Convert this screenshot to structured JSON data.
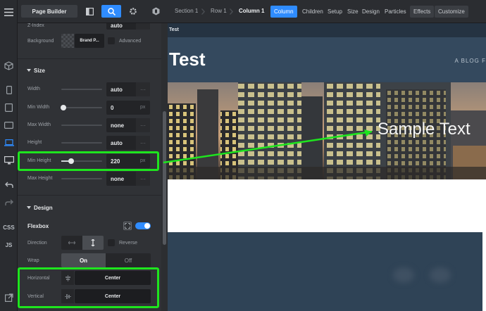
{
  "topbar": {
    "page_builder": "Page Builder",
    "breadcrumbs": [
      "Section 1",
      "Row 1",
      "Column 1"
    ],
    "tabs": [
      "Column",
      "Children",
      "Setup",
      "Size",
      "Design",
      "Particles"
    ],
    "boxed_tabs": [
      "Effects",
      "Customize"
    ],
    "icons": [
      "panel-toggle-icon",
      "search-icon",
      "gear-icon",
      "brand-icon"
    ]
  },
  "rail": {
    "icons": [
      "cube-icon",
      "mobile-icon",
      "tablet-portrait-icon",
      "tablet-landscape-icon",
      "laptop-icon",
      "desktop-icon",
      "undo-icon",
      "redo-icon",
      "external-link-icon"
    ],
    "css": "CSS",
    "js": "JS",
    "active": "laptop-icon"
  },
  "panel": {
    "zindex": {
      "label": "Z-Index",
      "value": "auto"
    },
    "background": {
      "label": "Background",
      "value": "Brand P...",
      "advanced": "Advanced"
    },
    "size_section": "Size",
    "size_rows": [
      {
        "label": "Width",
        "value": "auto",
        "unit": "···"
      },
      {
        "label": "Min Width",
        "value": "0",
        "unit": "px"
      },
      {
        "label": "Max Width",
        "value": "none",
        "unit": "···"
      },
      {
        "label": "Height",
        "value": "auto",
        "unit": "···"
      },
      {
        "label": "Min Height",
        "value": "220",
        "unit": "px"
      },
      {
        "label": "Max Height",
        "value": "none",
        "unit": "···"
      }
    ],
    "design_section": "Design",
    "flexbox": {
      "label": "Flexbox",
      "enabled": true
    },
    "direction": {
      "label": "Direction",
      "reverse": "Reverse"
    },
    "wrap": {
      "label": "Wrap",
      "on": "On",
      "off": "Off"
    },
    "horizontal": {
      "label": "Horizontal",
      "value": "Center"
    },
    "vertical": {
      "label": "Vertical",
      "value": "Center"
    }
  },
  "canvas": {
    "top_label": "Test",
    "site_title": "Test",
    "tagline": "A BLOG F",
    "sample_text": "Sample Text"
  },
  "colors": {
    "accent": "#2f8cff",
    "highlight": "#1ee51e"
  }
}
